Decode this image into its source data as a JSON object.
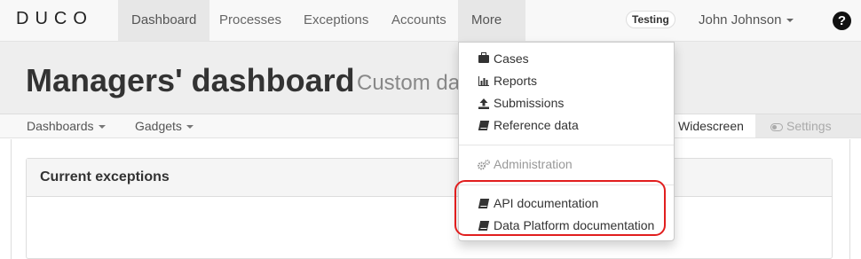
{
  "navbar": {
    "logo": "DUCO",
    "items": [
      {
        "label": "Dashboard"
      },
      {
        "label": "Processes"
      },
      {
        "label": "Exceptions"
      },
      {
        "label": "Accounts"
      },
      {
        "label": "More"
      }
    ],
    "env_badge": "Testing",
    "user_name": "John Johnson",
    "help_label": "?"
  },
  "header": {
    "title": "Managers' dashboard",
    "subtitle": "Custom da"
  },
  "toolbar": {
    "dashboards_label": "Dashboards",
    "gadgets_label": "Gadgets",
    "widescreen_label": "Widescreen",
    "settings_label": "Settings"
  },
  "panel": {
    "title": "Current exceptions"
  },
  "more_menu": {
    "items": [
      {
        "label": "Cases",
        "icon": "briefcase-icon"
      },
      {
        "label": "Reports",
        "icon": "bar-chart-icon"
      },
      {
        "label": "Submissions",
        "icon": "upload-icon"
      },
      {
        "label": "Reference data",
        "icon": "book-icon"
      },
      {
        "label": "Administration",
        "icon": "cogs-icon"
      },
      {
        "label": "API documentation",
        "icon": "book-icon"
      },
      {
        "label": "Data Platform documentation",
        "icon": "book-icon"
      }
    ]
  },
  "colors": {
    "highlight": "#e11e1e",
    "navbar_bg": "#f8f8f8",
    "header_bg": "#eeeeee"
  }
}
